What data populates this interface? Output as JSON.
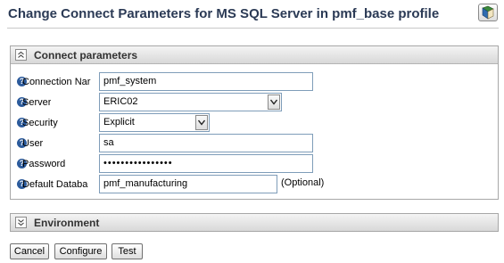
{
  "page": {
    "title": "Change Connect Parameters for MS SQL Server in pmf_base profile"
  },
  "connect_panel": {
    "title": "Connect parameters",
    "fields": [
      {
        "label": "Connection Nar",
        "value": "pmf_system"
      },
      {
        "label": "Server",
        "value": "ERIC02"
      },
      {
        "label": "Security",
        "value": "Explicit"
      },
      {
        "label": "User",
        "value": "sa"
      },
      {
        "label": "Password",
        "value": "••••••••••••••••"
      },
      {
        "label": "Default Databa",
        "value": "pmf_manufacturing",
        "note": "(Optional)"
      }
    ]
  },
  "environment_panel": {
    "title": "Environment"
  },
  "help_icon_glyph": "?",
  "buttons": {
    "cancel": "Cancel",
    "configure": "Configure",
    "test": "Test"
  }
}
